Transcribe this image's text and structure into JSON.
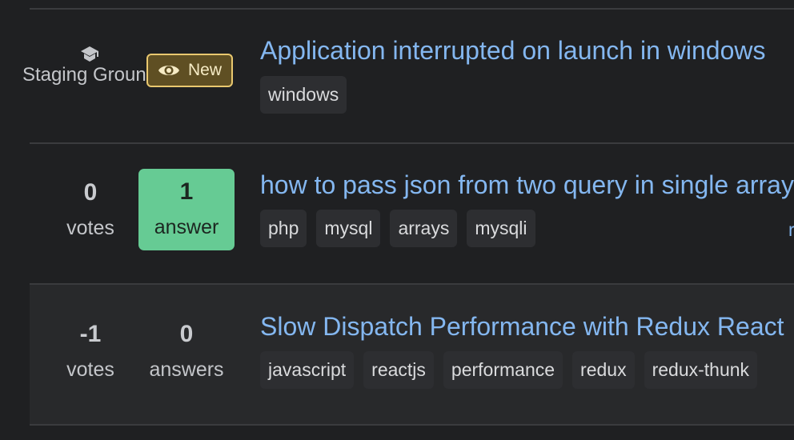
{
  "questions": [
    {
      "staging_ground": true,
      "staging_label": "Staging Ground",
      "staging_icon": "graduation-cap-icon",
      "badge": {
        "icon": "eye-icon",
        "label": "New"
      },
      "title": "Application interrupted on launch in windows",
      "tags": [
        "windows"
      ]
    },
    {
      "votes": "0",
      "votes_label": "votes",
      "answers": "1",
      "answers_label": "answer",
      "answered": true,
      "title": "how to pass json from two query in single array",
      "tags": [
        "php",
        "mysql",
        "arrays",
        "mysqli"
      ],
      "owner_link_partial": "r"
    },
    {
      "votes": "-1",
      "votes_label": "votes",
      "answers": "0",
      "answers_label": "answers",
      "answered": false,
      "title": "Slow Dispatch Performance with Redux React",
      "tags": [
        "javascript",
        "reactjs",
        "performance",
        "redux",
        "redux-thunk"
      ]
    }
  ],
  "colors": {
    "background": "#1f2022",
    "highlight_row": "#28292b",
    "link": "#84b7f0",
    "answered_green": "#66cb94",
    "new_badge_bg": "#5f4f23",
    "new_badge_border": "#e9c86f"
  }
}
